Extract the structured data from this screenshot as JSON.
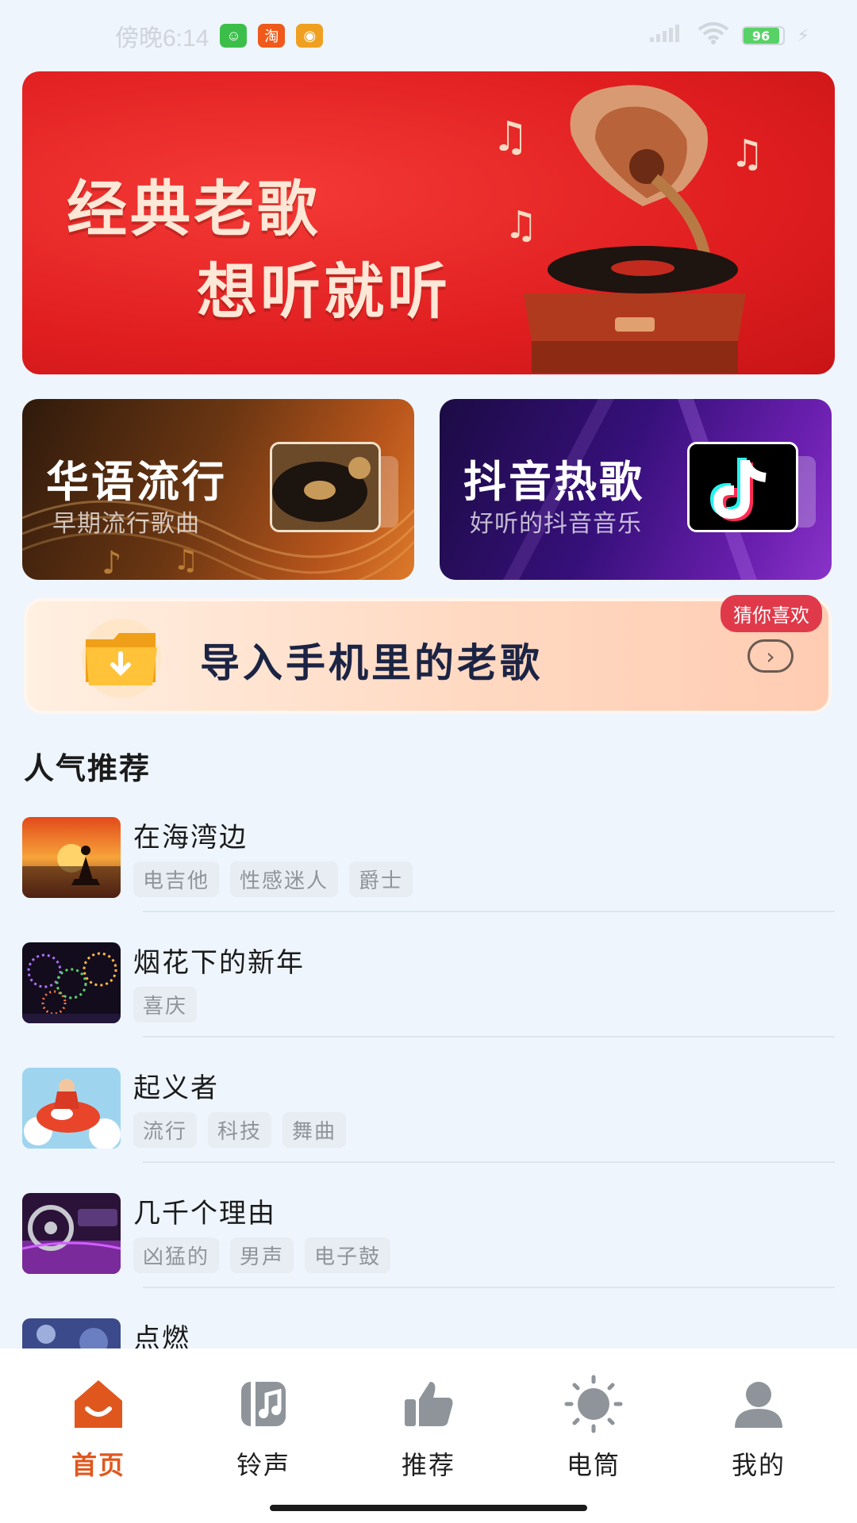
{
  "status_bar": {
    "time": "傍晚6:14",
    "battery": "96",
    "app_badges": [
      {
        "name": "cat-app-icon",
        "glyph": "☺",
        "color": "#3bbf4a"
      },
      {
        "name": "taobao-app-icon",
        "glyph": "淘",
        "color": "#ef5a1a"
      },
      {
        "name": "weibo-app-icon",
        "glyph": "◉",
        "color": "#f0a020"
      }
    ]
  },
  "banner": {
    "line1": "经典老歌",
    "line2": "想听就听"
  },
  "categories": [
    {
      "title": "华语流行",
      "subtitle": "早期流行歌曲"
    },
    {
      "title": "抖音热歌",
      "subtitle": "好听的抖音音乐"
    }
  ],
  "import": {
    "title": "导入手机里的老歌",
    "badge": "猜你喜欢",
    "arrow": "›"
  },
  "section": {
    "title": "人气推荐"
  },
  "songs": [
    {
      "title": "在海湾边",
      "tags": [
        "电吉他",
        "性感迷人",
        "爵士"
      ]
    },
    {
      "title": "烟花下的新年",
      "tags": [
        "喜庆"
      ]
    },
    {
      "title": "起义者",
      "tags": [
        "流行",
        "科技",
        "舞曲"
      ]
    },
    {
      "title": "几千个理由",
      "tags": [
        "凶猛的",
        "男声",
        "电子鼓"
      ]
    },
    {
      "title": "点燃",
      "tags": []
    }
  ],
  "nav": [
    {
      "label": "首页",
      "icon": "home-icon",
      "active": true
    },
    {
      "label": "铃声",
      "icon": "ringtone-icon",
      "active": false
    },
    {
      "label": "推荐",
      "icon": "thumbs-up-icon",
      "active": false
    },
    {
      "label": "电筒",
      "icon": "flashlight-icon",
      "active": false
    },
    {
      "label": "我的",
      "icon": "user-icon",
      "active": false
    }
  ],
  "colors": {
    "accent": "#e0571e",
    "background": "#eef5fd",
    "banner_red": "#e01e20"
  }
}
